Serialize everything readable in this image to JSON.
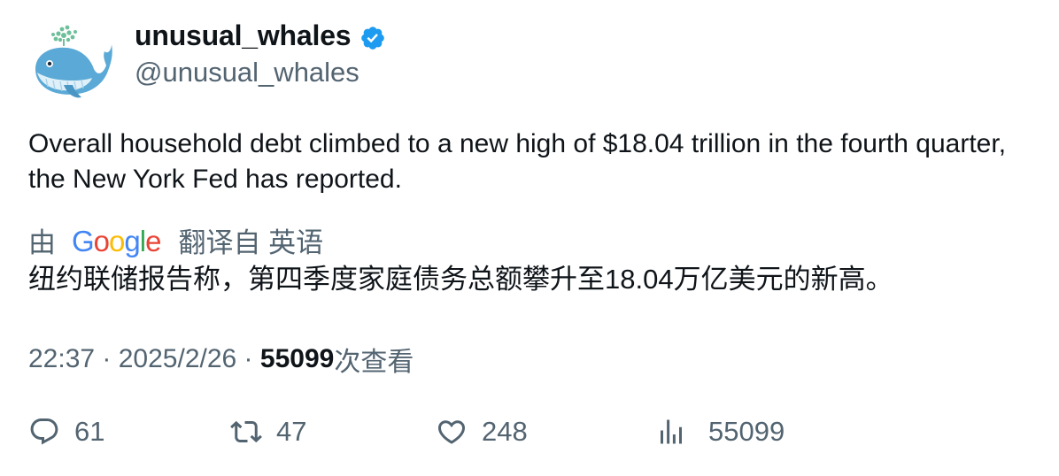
{
  "author": {
    "display_name": "unusual_whales",
    "handle": "@unusual_whales",
    "verified": true,
    "avatar_icon": "whale-avatar",
    "verified_color": "#1d9bf0"
  },
  "tweet": {
    "text": "Overall household debt climbed to a new high of $18.04 trillion in the fourth quarter, the New York Fed has reported."
  },
  "translation": {
    "by_label": "由",
    "provider": "Google",
    "from_label": "翻译自 英语",
    "text": "纽约联储报告称，第四季度家庭债务总额攀升至18.04万亿美元的新高。"
  },
  "meta": {
    "time": "22:37",
    "separator": " · ",
    "date": "2025/2/26",
    "views_count": "55099",
    "views_label": "次查看"
  },
  "actions": {
    "reply_count": "61",
    "retweet_count": "47",
    "like_count": "248",
    "views_count": "55099"
  },
  "colors": {
    "text_primary": "#0f1419",
    "text_secondary": "#536471",
    "google_blue": "#4285F4",
    "google_red": "#EA4335",
    "google_yellow": "#FBBC05",
    "google_green": "#34A853"
  }
}
